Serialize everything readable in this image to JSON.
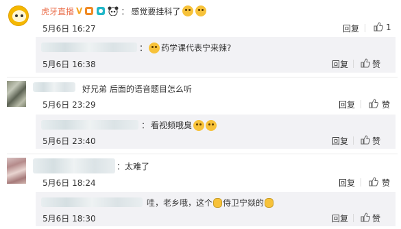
{
  "comments": [
    {
      "name": "虎牙直播",
      "verified_badge": "V",
      "text": "感觉要挂科了",
      "time": "5月6日 16:27",
      "reply_label": "回复",
      "like_count": "1",
      "replies": [
        {
          "text": "药学课代表宁来辣?",
          "time": "5月6日 16:38",
          "reply_label": "回复",
          "like_label": "赞"
        }
      ]
    },
    {
      "text": "好兄弟 后面的语音题目怎么听",
      "time": "5月6日 23:29",
      "reply_label": "回复",
      "like_label": "赞",
      "replies": [
        {
          "text": "看视频哦臭",
          "time": "5月6日 23:40",
          "reply_label": "回复",
          "like_label": "赞"
        }
      ]
    },
    {
      "text": "太难了",
      "time": "5月6日 18:24",
      "reply_label": "回复",
      "like_label": "赞",
      "replies": [
        {
          "text_a": "哇，老乡哦，这个",
          "text_b": "侍卫宁燚的",
          "time": "5月6日 18:30",
          "reply_label": "回复",
          "like_label": "赞"
        }
      ]
    }
  ],
  "colors": {
    "username": "#eb7350",
    "reply_bg": "#f2f2f5",
    "badge": "#f5a623"
  },
  "icons": [
    "tiger-avatar-icon",
    "verified-v-icon",
    "level-badge-icon",
    "cyan-badge-icon",
    "panda-icon",
    "laughing-cry-emoji-icon",
    "shocked-emoji-icon",
    "smile-emoji-icon",
    "fist-emoji-icon",
    "thumbs-up-icon"
  ]
}
